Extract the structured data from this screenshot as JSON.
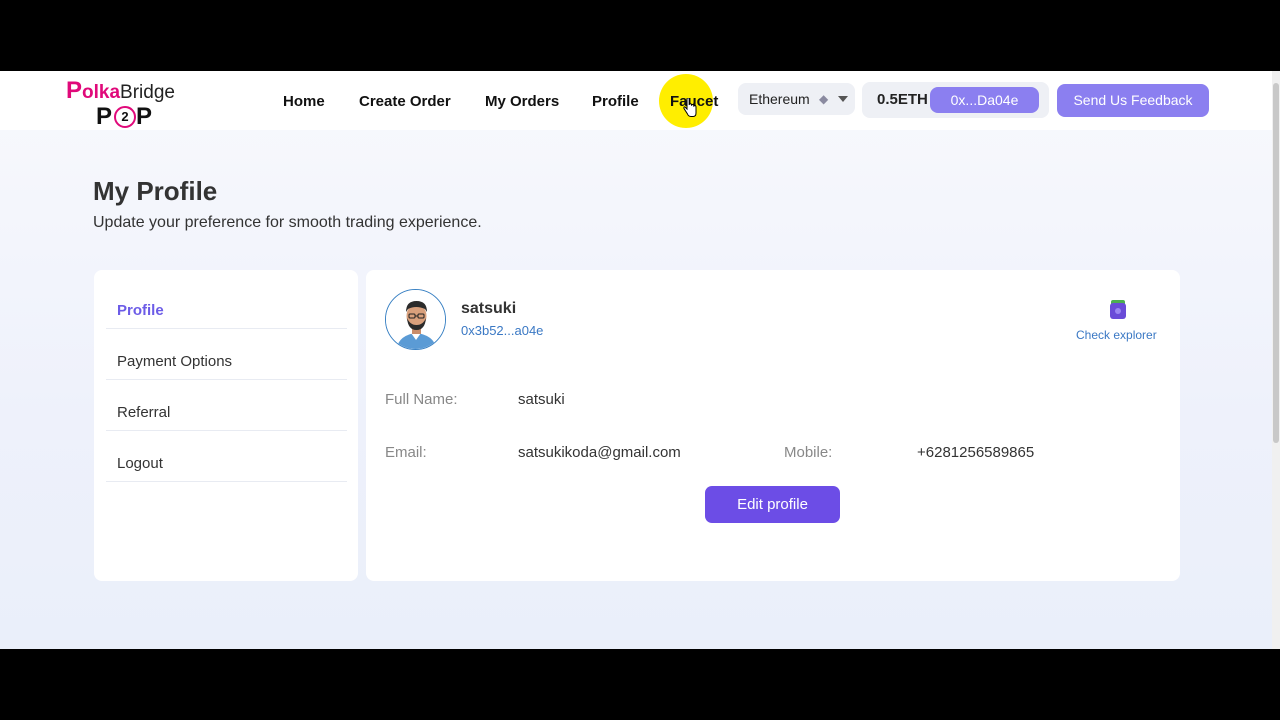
{
  "header": {
    "logo": {
      "p": "P",
      "olka": "olka",
      "bridge": "Bridge",
      "p2p_left": "P",
      "p2p_mid": "2",
      "p2p_right": "P"
    },
    "nav": [
      {
        "label": "Home"
      },
      {
        "label": "Create Order"
      },
      {
        "label": "My Orders"
      },
      {
        "label": "Profile"
      },
      {
        "label": "Faucet"
      }
    ],
    "chain": {
      "label": "Ethereum",
      "icon": "ethereum-icon"
    },
    "wallet": {
      "balance": "0.5ETH",
      "address": "0x...Da04e"
    },
    "feedback_label": "Send Us Feedback"
  },
  "page": {
    "title": "My Profile",
    "subtitle": "Update your preference for smooth trading experience."
  },
  "sidebar": {
    "items": [
      {
        "label": "Profile",
        "active": true
      },
      {
        "label": "Payment Options"
      },
      {
        "label": "Referral"
      },
      {
        "label": "Logout"
      }
    ]
  },
  "profile": {
    "username": "satsuki",
    "address": "0x3b52...a04e",
    "explorer_label": "Check explorer",
    "fields": {
      "full_name_label": "Full Name:",
      "full_name": "satsuki",
      "email_label": "Email:",
      "email": "satsukikoda@gmail.com",
      "mobile_label": "Mobile:",
      "mobile": "+6281256589865"
    },
    "edit_label": "Edit profile"
  },
  "colors": {
    "accent": "#6c4de6",
    "accent_light": "#8b7ff0",
    "brand_pink": "#e0097a",
    "link_blue": "#3a78c4",
    "cursor_highlight": "#ffee00"
  }
}
